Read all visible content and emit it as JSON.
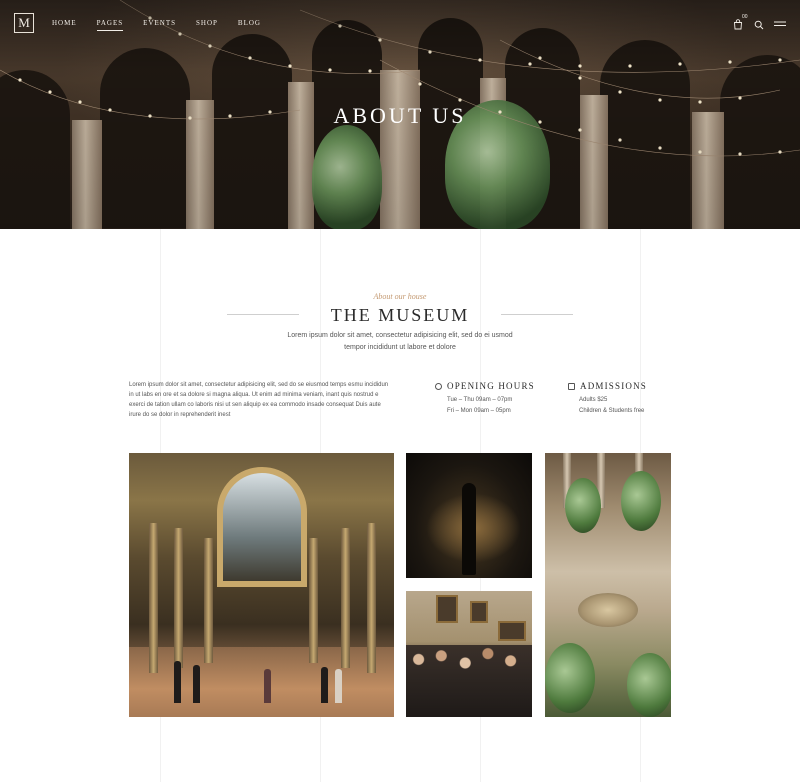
{
  "header": {
    "logo": "M",
    "nav": [
      {
        "label": "HOME",
        "active": false
      },
      {
        "label": "PAGES",
        "active": true
      },
      {
        "label": "EVENTS",
        "active": false
      },
      {
        "label": "SHOP",
        "active": false
      },
      {
        "label": "BLOG",
        "active": false
      }
    ],
    "cart_icon": "shopping-bag-icon",
    "cart_count": "00",
    "search_icon": "search-icon",
    "menu_icon": "hamburger-menu-icon"
  },
  "hero": {
    "title": "ABOUT US"
  },
  "intro": {
    "eyebrow": "About our house",
    "title": "THE MUSEUM",
    "subtitle": "Lorem ipsum dolor sit amet, consectetur adipisicing elit, sed do ei usmod tempor incididunt ut labore et dolore"
  },
  "info": {
    "paragraph": "Lorem ipsum dolor sit amet, consectetur adipisicing elit, sed do se eiusmod temps esmu incididun in ut labs en ore et sa dolore si magna aliqua. Ut enim ad minima veniam, inant quis nostrud e exerci de tation ullam co laboris nisi ut sen aliquip ex ea commodo insade consequat Duis aute irure do se dolor in reprehenderit inest",
    "hours": {
      "icon": "clock-icon",
      "title": "OPENING HOURS",
      "lines": [
        "Tue – Thu  09am – 07pm",
        "Fri – Mon  09am – 05pm"
      ]
    },
    "admissions": {
      "icon": "ticket-icon",
      "title": "ADMISSIONS",
      "lines": [
        "Adults  $25",
        "Children & Students  free"
      ]
    }
  },
  "colors": {
    "accent": "#c49a72",
    "text": "#2a2a2a",
    "muted": "#555555"
  }
}
